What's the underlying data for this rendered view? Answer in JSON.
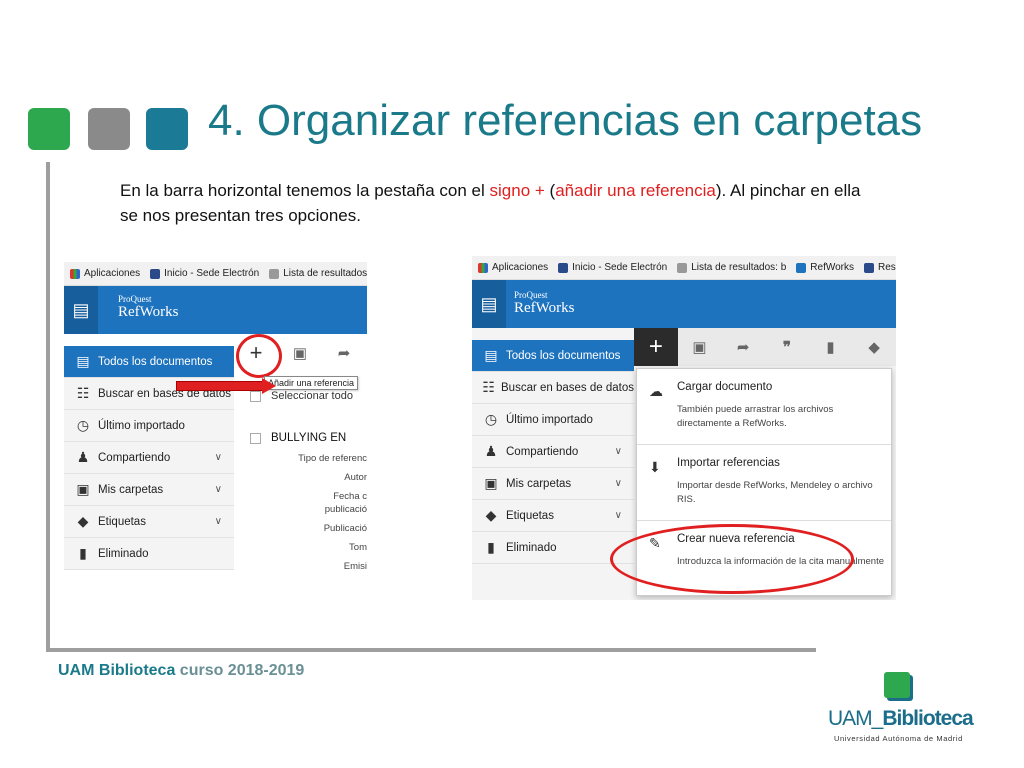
{
  "slide": {
    "title": "4. Organizar referencias en carpetas",
    "intro_part1": "En la barra horizontal tenemos la pestaña con el ",
    "intro_red1": "signo +",
    "intro_part2": " (",
    "intro_red2": "añadir una referencia",
    "intro_part3": "). Al pinchar en ella se nos presentan tres opciones.",
    "footer_bold": "UAM Biblioteca",
    "footer_light": " curso 2018-2019",
    "colors": {
      "title": "#1b7a8a",
      "green": "#2ea84e",
      "gray": "#8a8a8a",
      "teal": "#1b7a96",
      "red": "#e02020"
    }
  },
  "logo": {
    "prefix": "UAM_",
    "name": "Biblioteca",
    "subtitle": "Universidad Autónoma de Madrid"
  },
  "shot1": {
    "bookmarks": [
      "Aplicaciones",
      "Inicio - Sede Electrón",
      "Lista de resultados"
    ],
    "brand_small": "ProQuest",
    "brand": "RefWorks",
    "sidebar": [
      {
        "label": "Todos los documentos",
        "icon": "document-icon"
      },
      {
        "label": "Buscar en bases de datos",
        "icon": "database-icon"
      },
      {
        "label": "Último importado",
        "icon": "clock-icon"
      },
      {
        "label": "Compartiendo",
        "icon": "users-icon"
      },
      {
        "label": "Mis carpetas",
        "icon": "folder-icon"
      },
      {
        "label": "Etiquetas",
        "icon": "tag-icon"
      },
      {
        "label": "Eliminado",
        "icon": "trash-icon"
      }
    ],
    "tooltip": "Añadir una referencia",
    "select_all": "Seleccionar todo",
    "ref_title": "BULLYING EN",
    "meta": [
      "Tipo de referenc",
      "Autor",
      "Fecha c",
      "publicació",
      "Publicació",
      "Tom",
      "Emisi"
    ]
  },
  "shot2": {
    "bookmarks": [
      "Aplicaciones",
      "Inicio - Sede Electrón",
      "Lista de resultados: b",
      "RefWorks",
      "Resu"
    ],
    "brand_small": "ProQuest",
    "brand": "RefWorks",
    "sidebar": [
      {
        "label": "Todos los documentos",
        "icon": "document-icon"
      },
      {
        "label": "Buscar en bases de datos",
        "icon": "database-icon"
      },
      {
        "label": "Último importado",
        "icon": "clock-icon"
      },
      {
        "label": "Compartiendo",
        "icon": "users-icon"
      },
      {
        "label": "Mis carpetas",
        "icon": "folder-icon"
      },
      {
        "label": "Etiquetas",
        "icon": "tag-icon"
      },
      {
        "label": "Eliminado",
        "icon": "trash-icon"
      }
    ],
    "options": [
      {
        "title": "Cargar documento",
        "desc": "También puede arrastrar los archivos directamente a RefWorks.",
        "icon": "cloud-upload-icon"
      },
      {
        "title": "Importar referencias",
        "desc": "Importar desde RefWorks, Mendeley o archivo RIS.",
        "icon": "download-icon"
      },
      {
        "title": "Crear nueva referencia",
        "desc": "Introduzca la información de la cita manualmente",
        "icon": "edit-icon"
      }
    ]
  }
}
